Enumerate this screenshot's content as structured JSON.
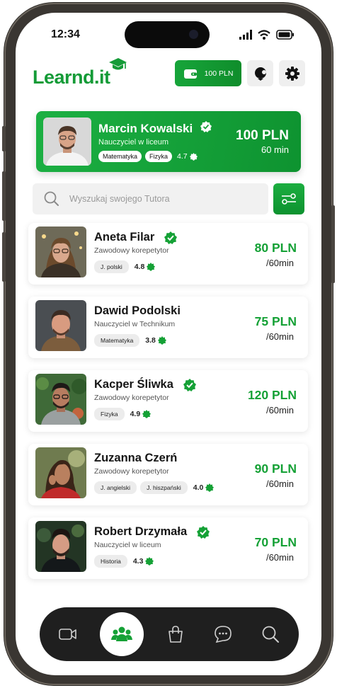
{
  "status_bar": {
    "time": "12:34"
  },
  "header": {
    "logo": "Learnd.it",
    "wallet_label": "100 PLN"
  },
  "featured": {
    "name": "Marcin Kowalski",
    "subtitle": "Nauczyciel w liceum",
    "tags": [
      "Matematyka",
      "Fizyka"
    ],
    "rating": "4.7",
    "price": "100 PLN",
    "per": "60 min"
  },
  "search": {
    "placeholder": "Wyszukaj swojego Tutora"
  },
  "tutors": [
    {
      "name": "Aneta Filar",
      "subtitle": "Zawodowy korepetytor",
      "tags": [
        "J. polski"
      ],
      "rating": "4.8",
      "price": "80 PLN",
      "per": "/60min",
      "verified": true
    },
    {
      "name": "Dawid Podolski",
      "subtitle": "Nauczyciel w Technikum",
      "tags": [
        "Matematyka"
      ],
      "rating": "3.8",
      "price": "75 PLN",
      "per": "/60min",
      "verified": false
    },
    {
      "name": "Kacper Śliwka",
      "subtitle": "Zawodowy korepetytor",
      "tags": [
        "Fizyka"
      ],
      "rating": "4.9",
      "price": "120 PLN",
      "per": "/60min",
      "verified": true
    },
    {
      "name": "Zuzanna Czerń",
      "subtitle": "Zawodowy korepetytor",
      "tags": [
        "J. angielski",
        "J. hiszpański"
      ],
      "rating": "4.0",
      "price": "90 PLN",
      "per": "/60min",
      "verified": false
    },
    {
      "name": "Robert Drzymała",
      "subtitle": "Nauczyciel w liceum",
      "tags": [
        "Historia"
      ],
      "rating": "4.3",
      "price": "70 PLN",
      "per": "/60min",
      "verified": true
    }
  ],
  "bottom_nav": {
    "items": [
      "video-icon",
      "users-icon",
      "shopping-bag-icon",
      "chat-icon",
      "search-icon"
    ],
    "active_index": 1
  },
  "colors": {
    "brand_green": "#149b37",
    "nav_dark": "#1f1f1f"
  }
}
